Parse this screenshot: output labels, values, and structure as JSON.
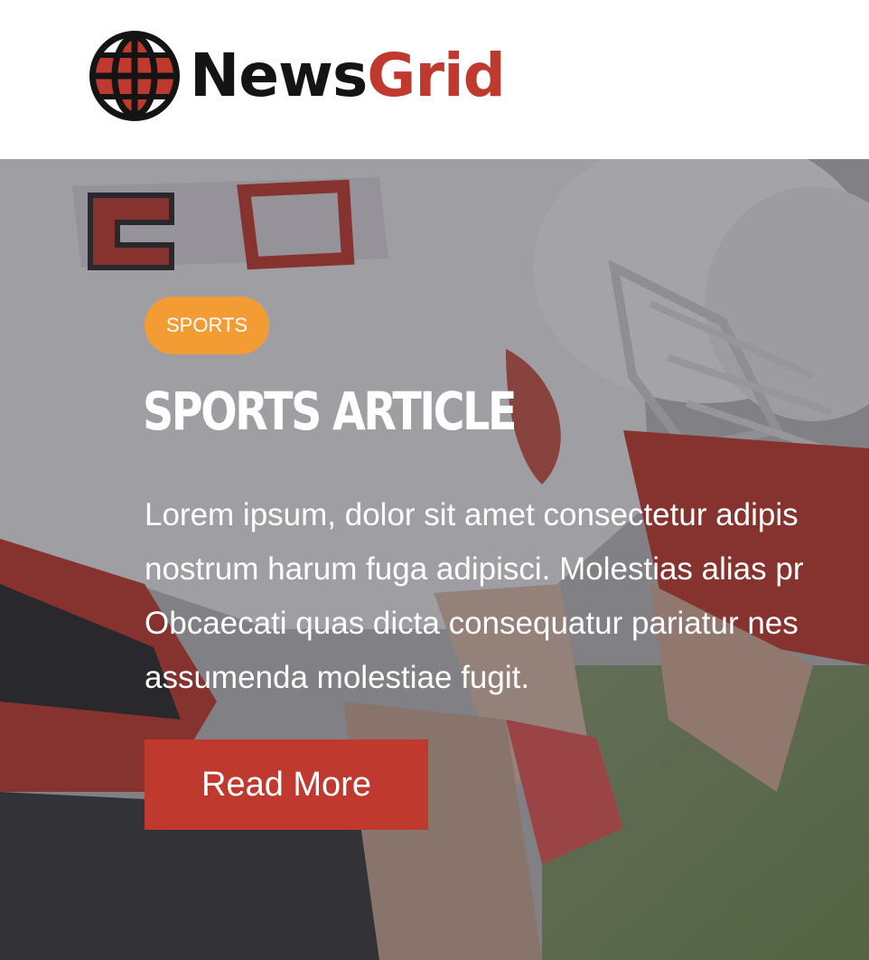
{
  "brand": {
    "name_part1": "News",
    "name_part2": "Grid",
    "colors": {
      "dark": "#141414",
      "accent": "#c0392f"
    },
    "icon": "globe-icon"
  },
  "hero": {
    "category": "SPORTS",
    "category_color": "#f39c33",
    "title": "Sports Article",
    "excerpt_lines": [
      "Lorem ipsum, dolor sit amet consectetur adipis",
      "nostrum harum fuga adipisci. Molestias alias pr",
      "Obcaecati quas dicta consequatur pariatur nes",
      "assumenda molestiae fugit."
    ],
    "cta_label": "Read More",
    "cta_color": "#c0392f",
    "background": "football-players-photo"
  }
}
